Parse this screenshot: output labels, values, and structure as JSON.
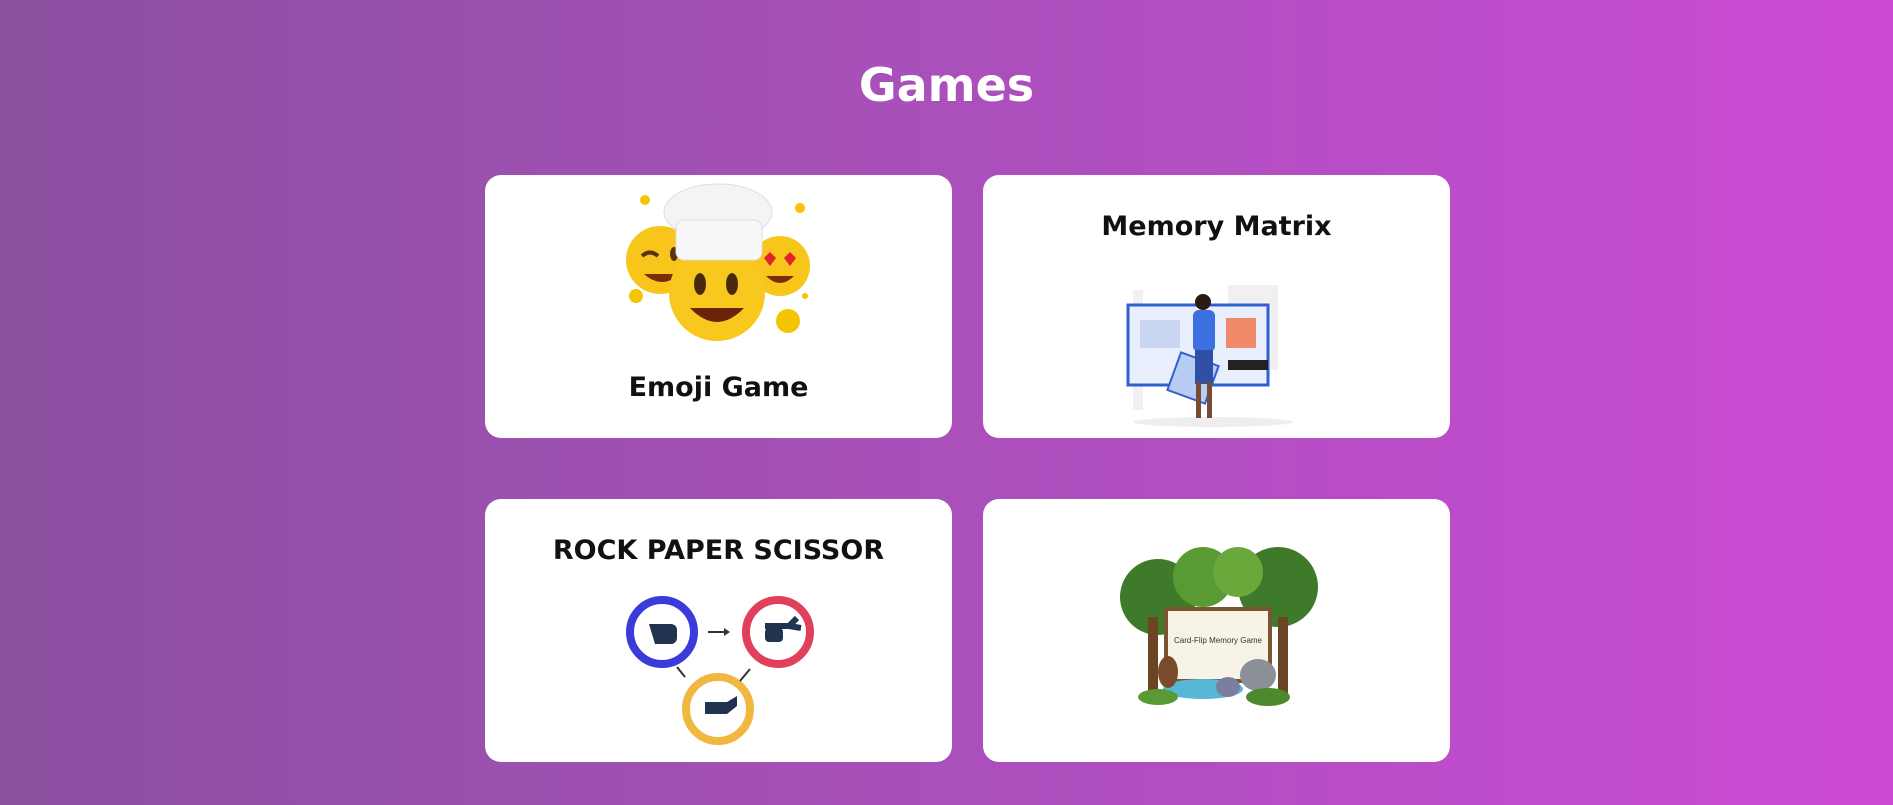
{
  "page": {
    "title": "Games"
  },
  "cards": [
    {
      "label": "Emoji Game",
      "icon": "emoji-faces-icon"
    },
    {
      "label": "Memory Matrix",
      "icon": "person-at-board-illustration"
    },
    {
      "label": "ROCK PAPER SCISSOR",
      "icon": "rock-paper-scissor-icon"
    },
    {
      "label": "",
      "icon": "card-flip-memory-game-illustration",
      "image_text": "Card-Flip Memory Game"
    }
  ]
}
